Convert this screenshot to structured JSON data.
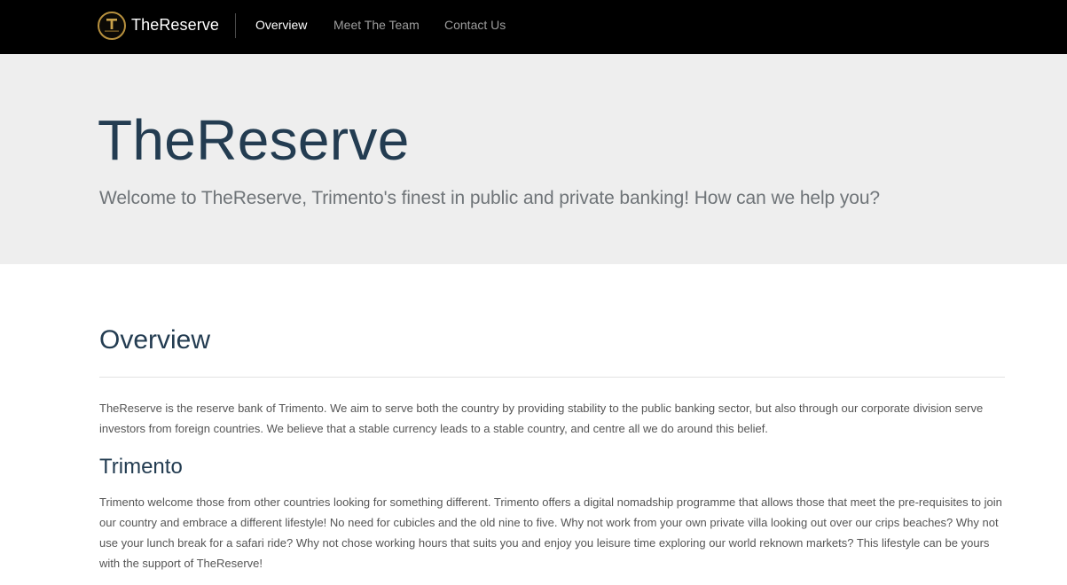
{
  "navbar": {
    "brand_name": "TheReserve",
    "logo_icon": "the-reserve-logo",
    "links": [
      {
        "label": "Overview",
        "active": true
      },
      {
        "label": "Meet The Team",
        "active": false
      },
      {
        "label": "Contact Us",
        "active": false
      }
    ]
  },
  "hero": {
    "title": "TheReserve",
    "subtitle": "Welcome to TheReserve, Trimento's finest in public and private banking! How can we help you?"
  },
  "main": {
    "overview_heading": "Overview",
    "overview_text": "TheReserve is the reserve bank of Trimento. We aim to serve both the country by providing stability to the public banking sector, but also through our corporate division serve investors from foreign countries. We believe that a stable currency leads to a stable country, and centre all we do around this belief.",
    "trimento_heading": "Trimento",
    "trimento_text": "Trimento welcome those from other countries looking for something different. Trimento offers a digital nomadship programme that allows those that meet the pre-requisites to join our country and embrace a different lifestyle! No need for cubicles and the old nine to five. Why not work from your own private villa looking out over our crips beaches? Why not use your lunch break for a safari ride? Why not chose working hours that suits you and enjoy you leisure time exploring our world reknown markets? This lifestyle can be yours with the support of TheReserve!"
  },
  "colors": {
    "navbar_bg": "#000000",
    "hero_bg": "#eeeeee",
    "heading": "#233c51",
    "body_text": "#555555",
    "logo_gold": "#b8913e"
  }
}
